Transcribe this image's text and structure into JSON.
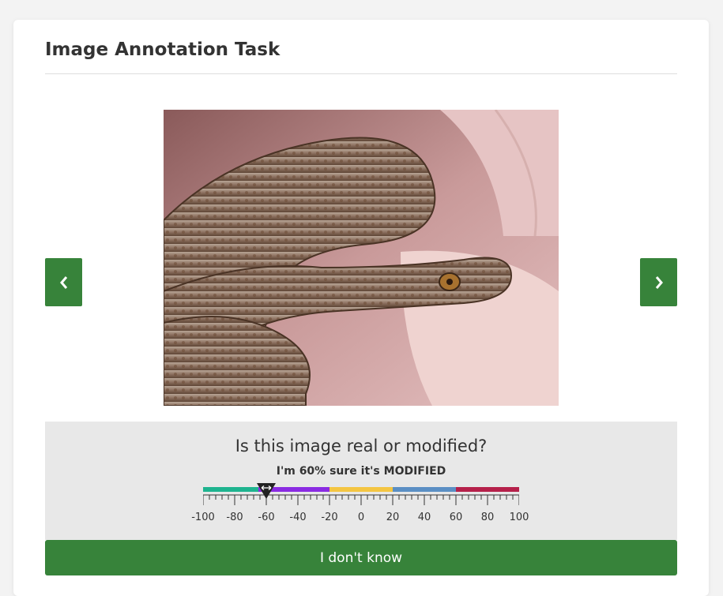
{
  "card": {
    "title": "Image Annotation Task"
  },
  "navigation": {
    "prev_icon": "chevron-left-icon",
    "next_icon": "chevron-right-icon"
  },
  "image": {
    "subject": "snake"
  },
  "annotation": {
    "question": "Is this image real or modified?",
    "status": "I'm 60% sure it's MODIFIED",
    "slider": {
      "min": -100,
      "max": 100,
      "value": -60,
      "tick_labels": [
        "-100",
        "-80",
        "-60",
        "-40",
        "-20",
        "0",
        "20",
        "40",
        "60",
        "80",
        "100"
      ],
      "segment_colors": [
        "#1eb38f",
        "#8a2be2",
        "#f4c542",
        "#5b8fc4",
        "#b5204a"
      ]
    }
  },
  "actions": {
    "idk_label": "I don't know"
  },
  "colors": {
    "primary_green": "#37833a",
    "panel_bg": "#e8e8e8"
  }
}
